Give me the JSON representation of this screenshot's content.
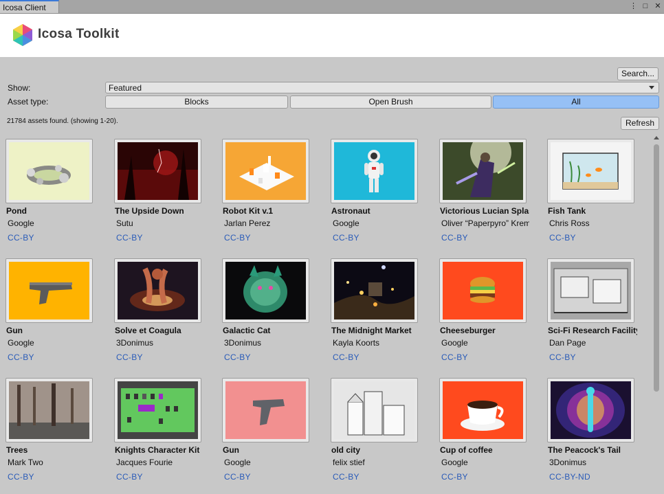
{
  "window": {
    "tab_label": "Icosa Client",
    "controls": [
      "⋮",
      "□",
      "✕"
    ]
  },
  "header": {
    "logo_text": "Icosa Toolkit"
  },
  "toolbar": {
    "search_label": "Search...",
    "show_label": "Show:",
    "show_value": "Featured",
    "asset_type_label": "Asset type:",
    "asset_types": [
      "Blocks",
      "Open Brush",
      "All"
    ],
    "active_asset_type": "All",
    "count_text": "21784 assets found. (showing 1-20).",
    "refresh_label": "Refresh"
  },
  "assets": [
    {
      "title": "Pond",
      "author": "Google",
      "license": "CC-BY",
      "thumb": "pond"
    },
    {
      "title": "The Upside Down",
      "author": "Sutu",
      "license": "CC-BY",
      "thumb": "upside"
    },
    {
      "title": "Robot Kit v.1",
      "author": "Jarlan Perez",
      "license": "CC-BY",
      "thumb": "robotkit"
    },
    {
      "title": "Astronaut",
      "author": "Google",
      "license": "CC-BY",
      "thumb": "astronaut"
    },
    {
      "title": "Victorious Lucian Splash",
      "author": "Oliver “Paperpyro” Kremer",
      "license": "CC-BY",
      "thumb": "lucian"
    },
    {
      "title": "Fish Tank",
      "author": "Chris Ross",
      "license": "CC-BY",
      "thumb": "fishtank"
    },
    {
      "title": "Gun",
      "author": "Google",
      "license": "CC-BY",
      "thumb": "gun1"
    },
    {
      "title": "Solve et Coagula",
      "author": "3Donimus",
      "license": "CC-BY",
      "thumb": "solve"
    },
    {
      "title": "Galactic Cat",
      "author": "3Donimus",
      "license": "CC-BY",
      "thumb": "cat"
    },
    {
      "title": "The Midnight Market",
      "author": "Kayla Koorts",
      "license": "CC-BY",
      "thumb": "midnight"
    },
    {
      "title": "Cheeseburger",
      "author": "Google",
      "license": "CC-BY",
      "thumb": "burger"
    },
    {
      "title": "Sci-Fi Research Facility",
      "author": "Dan Page",
      "license": "CC-BY",
      "thumb": "scifi"
    },
    {
      "title": "Trees",
      "author": "Mark Two",
      "license": "CC-BY",
      "thumb": "trees"
    },
    {
      "title": "Knights Character Kit",
      "author": "Jacques Fourie",
      "license": "CC-BY",
      "thumb": "knights"
    },
    {
      "title": "Gun",
      "author": "Google",
      "license": "CC-BY",
      "thumb": "gun2"
    },
    {
      "title": "old city",
      "author": "felix stief",
      "license": "CC-BY",
      "thumb": "oldcity"
    },
    {
      "title": "Cup of coffee",
      "author": "Google",
      "license": "CC-BY",
      "thumb": "coffee"
    },
    {
      "title": "The Peacock's Tail",
      "author": "3Donimus",
      "license": "CC-BY-ND",
      "thumb": "peacock"
    }
  ]
}
